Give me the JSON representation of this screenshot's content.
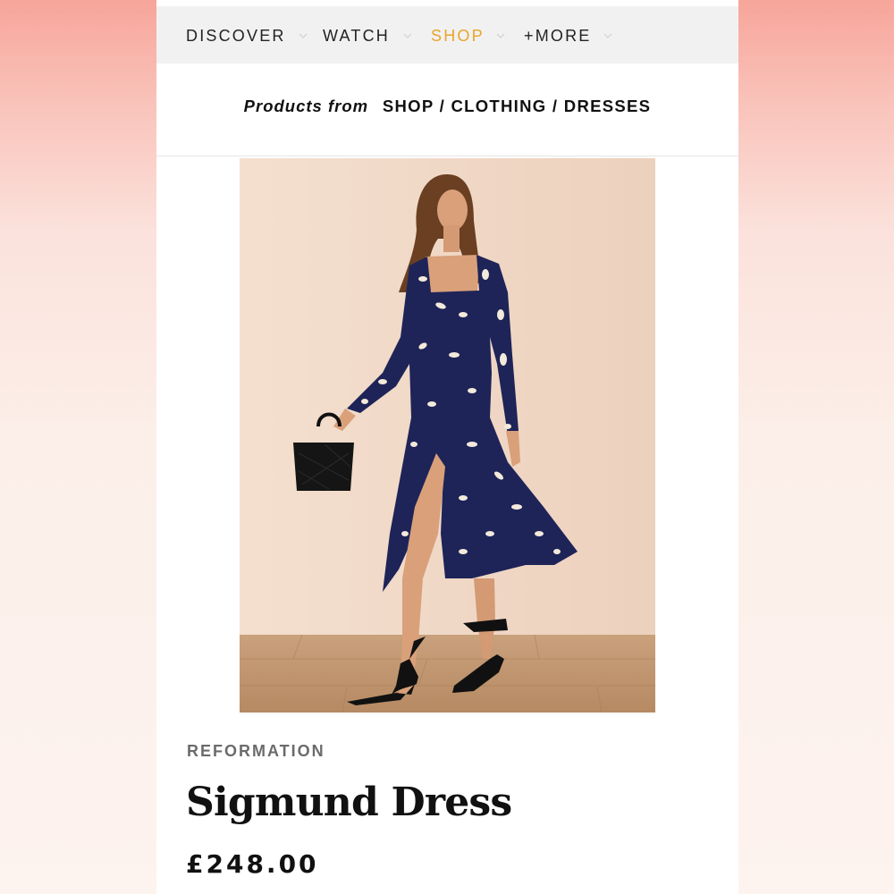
{
  "nav": {
    "items": [
      {
        "label": "DISCOVER",
        "active": false
      },
      {
        "label": "WATCH",
        "active": false
      },
      {
        "label": "SHOP",
        "active": true
      },
      {
        "label": "+MORE",
        "active": false
      }
    ],
    "accent_color": "#e8a52b",
    "chevron_icon": "chevron-down-icon"
  },
  "breadcrumb": {
    "prefix": "Products from",
    "path": "SHOP / CLOTHING / DRESSES"
  },
  "product": {
    "brand": "REFORMATION",
    "name": "Sigmund Dress",
    "price": "£248.00",
    "image_subject": "model wearing navy dress with cream print"
  }
}
